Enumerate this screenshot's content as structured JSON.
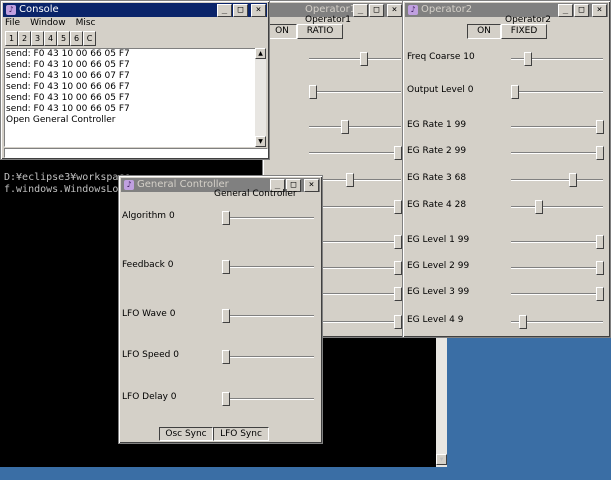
{
  "console": {
    "title": "Console",
    "menu": [
      "File",
      "Window",
      "Misc"
    ],
    "channel_buttons": [
      "1",
      "2",
      "3",
      "4",
      "5",
      "6",
      "C"
    ],
    "log": [
      "send: F0 43 10 00 66 05 F7",
      "send: F0 43 10 00 66 05 F7",
      "send: F0 43 10 00 66 07 F7",
      "send: F0 43 10 00 66 06 F7",
      "send: F0 43 10 00 66 05 F7",
      "send: F0 43 10 00 66 05 F7",
      "Open General Controller"
    ]
  },
  "terminal": {
    "lines": [
      "D:¥eclipse3¥workspace",
      "f.windows.WindowsLook"
    ]
  },
  "operator1": {
    "title": "Operator1",
    "buttons": [
      "ON",
      "RATIO"
    ],
    "slider_levels": [
      0.6,
      0.0,
      0.38,
      1.0,
      0.44,
      1.0,
      1.0,
      1.0,
      1.0,
      1.0
    ]
  },
  "operator2": {
    "title": "Operator2",
    "buttons": [
      "ON",
      "FIXED"
    ],
    "params": [
      {
        "label": "Freq Coarse 10",
        "level": 0.15
      },
      {
        "label": "Output Level  0",
        "level": 0.0
      },
      {
        "label": "EG Rate 1 99",
        "level": 1.0
      },
      {
        "label": "EG Rate 2 99",
        "level": 1.0
      },
      {
        "label": "EG Rate 3 68",
        "level": 0.68
      },
      {
        "label": "EG Rate 4 28",
        "level": 0.28
      },
      {
        "label": "EG Level 1 99",
        "level": 1.0
      },
      {
        "label": "EG Level 2 99",
        "level": 1.0
      },
      {
        "label": "EG Level 3 99",
        "level": 1.0
      },
      {
        "label": "EG Level 4 9",
        "level": 0.09
      }
    ]
  },
  "general_controller": {
    "title": "General Controller",
    "heading": "General Controller",
    "params": [
      {
        "label": "Algorithm 0",
        "level": 0.0
      },
      {
        "label": "Feedback 0",
        "level": 0.0
      },
      {
        "label": "LFO  Wave 0",
        "level": 0.0
      },
      {
        "label": "LFO  Speed 0",
        "level": 0.0
      },
      {
        "label": "LFO  Delay 0",
        "level": 0.0
      }
    ],
    "buttons": [
      "Osc Sync",
      "LFO Sync"
    ]
  },
  "window_buttons": {
    "minimize": "_",
    "maximize": "□",
    "close": "×"
  }
}
